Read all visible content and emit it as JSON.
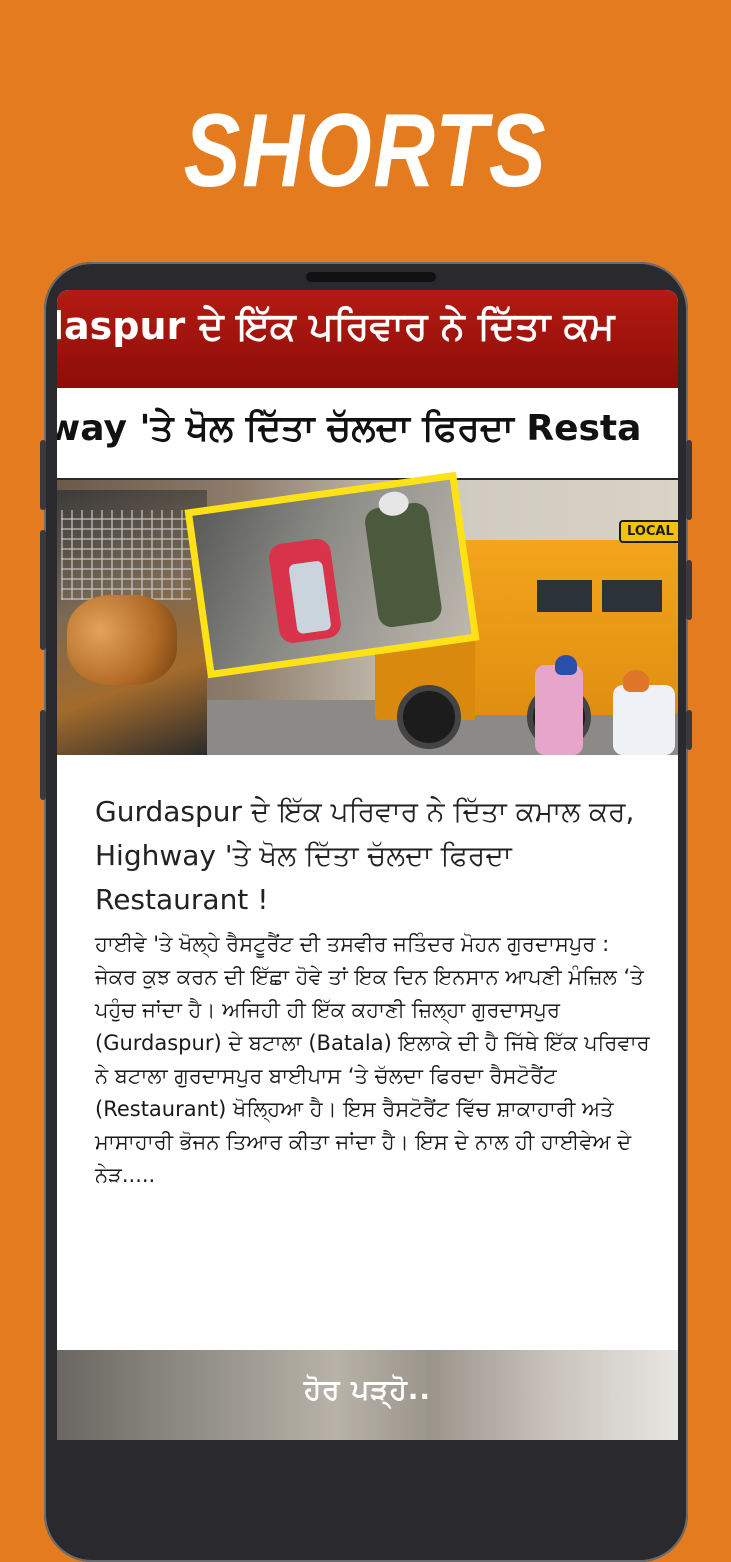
{
  "promo": {
    "title": "SHORTS"
  },
  "article": {
    "image_banner_line1": "laspur ਦੇ ਇੱਕ ਪਰਿਵਾਰ ਨੇ ਦਿੱਤਾ ਕਮ",
    "image_banner_line2": "way 'ਤੇ ਖੋਲ ਦਿੱਤਾ ਚੱਲਦਾ ਫਿਰਦਾ Resta",
    "image_badge": "LOCAL",
    "headline": "Gurdaspur ਦੇ ਇੱਕ ਪਰਿਵਾਰ ਨੇ ਦਿੱਤਾ ਕਮਾਲ ਕਰ, Highway 'ਤੇ ਖੋਲ ਦਿੱਤਾ ਚੱਲਦਾ ਫਿਰਦਾ Restaurant !",
    "excerpt": "ਹਾਈਵੇ 'ਤੇ ਖੋਲ੍ਹੇ ਰੈਸਟੂਰੈਂਟ ਦੀ ਤਸਵੀਰ ਜਤਿੰਦਰ ਮੋਹਨ ਗੁਰਦਾਸਪੁਰ : ਜੇਕਰ ਕੁਝ ਕਰਨ ਦੀ ਇੱਛਾ ਹੋਵੇ ਤਾਂ ਇਕ ਦਿਨ ਇਨਸਾਨ ਆਪਣੀ ਮੰਜ਼ਿਲ ‘ਤੇ ਪਹੁੰਚ ਜਾਂਦਾ ਹੈ। ਅਜਿਹੀ ਹੀ ਇੱਕ ਕਹਾਣੀ ਜ਼ਿਲ੍ਹਾ ਗੁਰਦਾਸਪੁਰ (Gurdaspur) ਦੇ ਬਟਾਲਾ (Batala) ਇਲਾਕੇ ਦੀ ਹੈ ਜਿੱਥੇ ਇੱਕ ਪਰਿਵਾਰ ਨੇ ਬਟਾਲਾ ਗੁਰਦਾਸਪੁਰ ਬਾਈਪਾਸ ‘ਤੇ ਚੱਲਦਾ ਫਿਰਦਾ ਰੈਸਟੋਰੈਂਟ (Restaurant) ਖੋਲ੍ਹਿਆ ਹੈ। ਇਸ ਰੈਸਟੋਰੈਂਟ ਵਿੱਚ ਸ਼ਾਕਾਹਾਰੀ ਅਤੇ ਮਾਸਾਹਾਰੀ ਭੋਜਨ ਤਿਆਰ ਕੀਤਾ ਜਾਂਦਾ ਹੈ। ਇਸ ਦੇ ਨਾਲ ਹੀ ਹਾਈਵੇਅ ਦੇ ਨੇੜ.....",
    "read_more": "ਹੋਰ ਪੜ੍ਹੋ.."
  },
  "colors": {
    "background": "#E47B1F",
    "banner_red": "#A3140D",
    "inset_frame": "#FFE215"
  }
}
